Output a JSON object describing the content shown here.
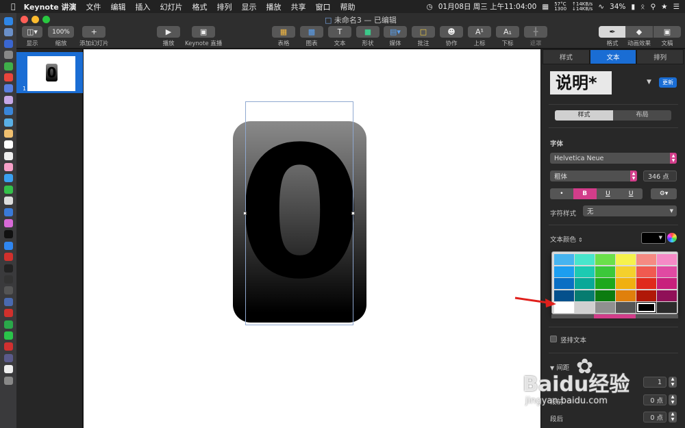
{
  "menubar": {
    "app": "Keynote 讲演",
    "items": [
      "文件",
      "编辑",
      "插入",
      "幻灯片",
      "格式",
      "排列",
      "显示",
      "播放",
      "共享",
      "窗口",
      "帮助"
    ],
    "status": {
      "temp": "57°C",
      "rpm": "1300",
      "up": "↑14KB/s",
      "down": "↓14KB/s",
      "battery": "34%",
      "datetime": "01月08日 周三 上午11:04:00"
    }
  },
  "window": {
    "title": "未命名3 — 已编辑"
  },
  "toolbar": {
    "view": "显示",
    "zoom_value": "100%",
    "zoom": "缩放",
    "add_slide": "添加幻灯片",
    "play": "播放",
    "keynote_live": "Keynote 直播",
    "table": "表格",
    "chart": "图表",
    "text": "文本",
    "shape": "形状",
    "media": "媒体",
    "comment": "批注",
    "collaborate": "协作",
    "superscript": "上标",
    "subscript": "下标",
    "mask": "遮罩",
    "format": "格式",
    "animate": "动画效果",
    "document": "文稿"
  },
  "navigator": {
    "slide_number": "1",
    "thumb_digit": "0"
  },
  "slide": {
    "digit": "0"
  },
  "inspector": {
    "tabs": [
      "样式",
      "文本",
      "排列"
    ],
    "paragraph_style": "说明*",
    "update": "更新",
    "subtabs": [
      "样式",
      "布局"
    ],
    "font_label": "字体",
    "font_family": "Helvetica Neue",
    "font_style": "粗体",
    "font_size": "346 点",
    "buttons": [
      "•",
      "B",
      "U",
      "U",
      "⚙▾"
    ],
    "char_style_label": "字符样式",
    "char_style": "无",
    "color_label": "文本颜色",
    "vertical_text": "竖排文本",
    "spacing": "间距",
    "line_value": "1",
    "before_label": "段前",
    "before": "0 点",
    "after_label": "段后",
    "after": "0 点"
  },
  "palette": {
    "colors": [
      [
        "#46b4f0",
        "#48e6cc",
        "#6be04a",
        "#f6f24c",
        "#f58a82",
        "#f58ac6"
      ],
      [
        "#1c9ef0",
        "#1ccab2",
        "#3cc83a",
        "#f4d02c",
        "#f05a50",
        "#e04aa2"
      ],
      [
        "#0a6fc4",
        "#08a898",
        "#1ea81c",
        "#f0b010",
        "#e02a1c",
        "#c8207c"
      ],
      [
        "#04508c",
        "#067c70",
        "#0c7c10",
        "#e0800c",
        "#b01808",
        "#901058"
      ],
      [
        "#ffffff",
        "#d0d0d0",
        "#909090",
        "#555555",
        "#000000",
        "#2b2b2b"
      ]
    ]
  },
  "watermark": {
    "brand": "Baidu经验",
    "url": "jingyan.baidu.com"
  }
}
